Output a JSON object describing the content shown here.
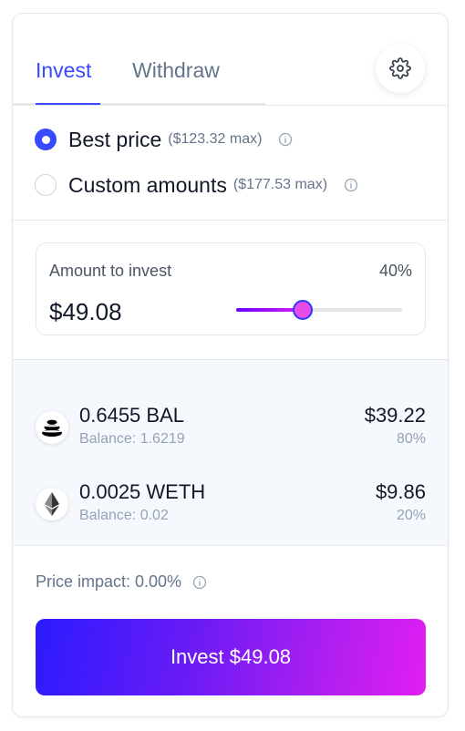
{
  "tabs": {
    "invest_label": "Invest",
    "withdraw_label": "Withdraw",
    "active": "Invest",
    "settings_icon": "gear-icon"
  },
  "options": [
    {
      "label": "Best price",
      "max": "($123.32 max)",
      "selected": true,
      "info_icon": "info-icon"
    },
    {
      "label": "Custom amounts",
      "max": "($177.53 max)",
      "selected": false,
      "info_icon": "info-icon"
    }
  ],
  "amount": {
    "title": "Amount to invest",
    "percent_label": "40%",
    "percent": 40,
    "value": "$49.08"
  },
  "tokens": [
    {
      "icon": "balancer-icon",
      "amount": "0.6455 BAL",
      "balance": "Balance: 1.6219",
      "usd": "$39.22",
      "weight": "80%"
    },
    {
      "icon": "ethereum-icon",
      "amount": "0.0025 WETH",
      "balance": "Balance: 0.02",
      "usd": "$9.86",
      "weight": "20%"
    }
  ],
  "price_impact": "Price impact: 0.00%",
  "invest_button": "Invest $49.08",
  "colors": {
    "accent": "#384aff",
    "muted": "#64748b",
    "panel_bg": "#f5f8fc",
    "button_gradient_start": "#2b1bff",
    "button_gradient_end": "#e21ef2"
  }
}
